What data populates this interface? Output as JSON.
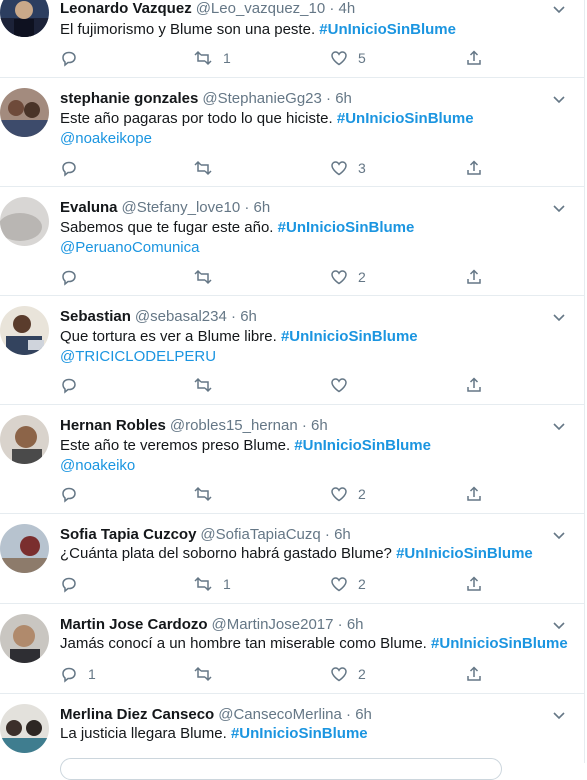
{
  "tweets": [
    {
      "name": "Leonardo Vazquez",
      "handle": "@Leo_vazquez_10",
      "time": "4h",
      "text": "El fujimorismo y Blume son una peste.",
      "hashtag": "#UnInicioSinBlume",
      "mention": "",
      "retweets": "1",
      "likes": "5"
    },
    {
      "name": "stephanie gonzales",
      "handle": "@StephanieGg23",
      "time": "6h",
      "text": "Este año pagaras por todo lo que hiciste.",
      "hashtag": "#UnInicioSinBlume",
      "mention": "@noakeikope",
      "retweets": "",
      "likes": "3"
    },
    {
      "name": "Evaluna",
      "handle": "@Stefany_love10",
      "time": "6h",
      "text": "Sabemos que te fugar este año.",
      "hashtag": "#UnInicioSinBlume",
      "mention": "@PeruanoComunica",
      "retweets": "",
      "likes": "2"
    },
    {
      "name": "Sebastian",
      "handle": "@sebasal234",
      "time": "6h",
      "text": "Que tortura es ver a Blume libre.",
      "hashtag": "#UnInicioSinBlume",
      "mention": "@TRICICLODELPERU",
      "retweets": "",
      "likes": ""
    },
    {
      "name": "Hernan Robles",
      "handle": "@robles15_hernan",
      "time": "6h",
      "text": "Este año te veremos preso Blume.",
      "hashtag": "#UnInicioSinBlume",
      "mention": "@noakeiko",
      "retweets": "",
      "likes": "2"
    },
    {
      "name": "Sofia Tapia Cuzcoy",
      "handle": "@SofiaTapiaCuzq",
      "time": "6h",
      "text": "¿Cuánta plata del soborno habrá gastado Blume?",
      "hashtag": "#UnInicioSinBlume",
      "mention": "",
      "retweets": "1",
      "likes": "2"
    },
    {
      "name": "Martin Jose Cardozo",
      "handle": "@MartinJose2017",
      "time": "6h",
      "text": "Jamás conocí a un hombre tan miserable como Blume.",
      "hashtag": "#UnInicioSinBlume",
      "mention": "",
      "replies": "1",
      "retweets": "",
      "likes": "2"
    },
    {
      "name": "Merlina Diez Canseco",
      "handle": "@CansecoMerlina",
      "time": "6h",
      "text": "La justicia llegara Blume.",
      "hashtag": "#UnInicioSinBlume",
      "mention": "",
      "retweets": "",
      "likes": ""
    }
  ],
  "colors": {
    "link": "#1b95e0",
    "muted": "#657786",
    "divider": "#e6ecf0"
  },
  "icons": [
    "reply-icon",
    "retweet-icon",
    "like-icon",
    "share-icon",
    "chevron-down-icon"
  ]
}
